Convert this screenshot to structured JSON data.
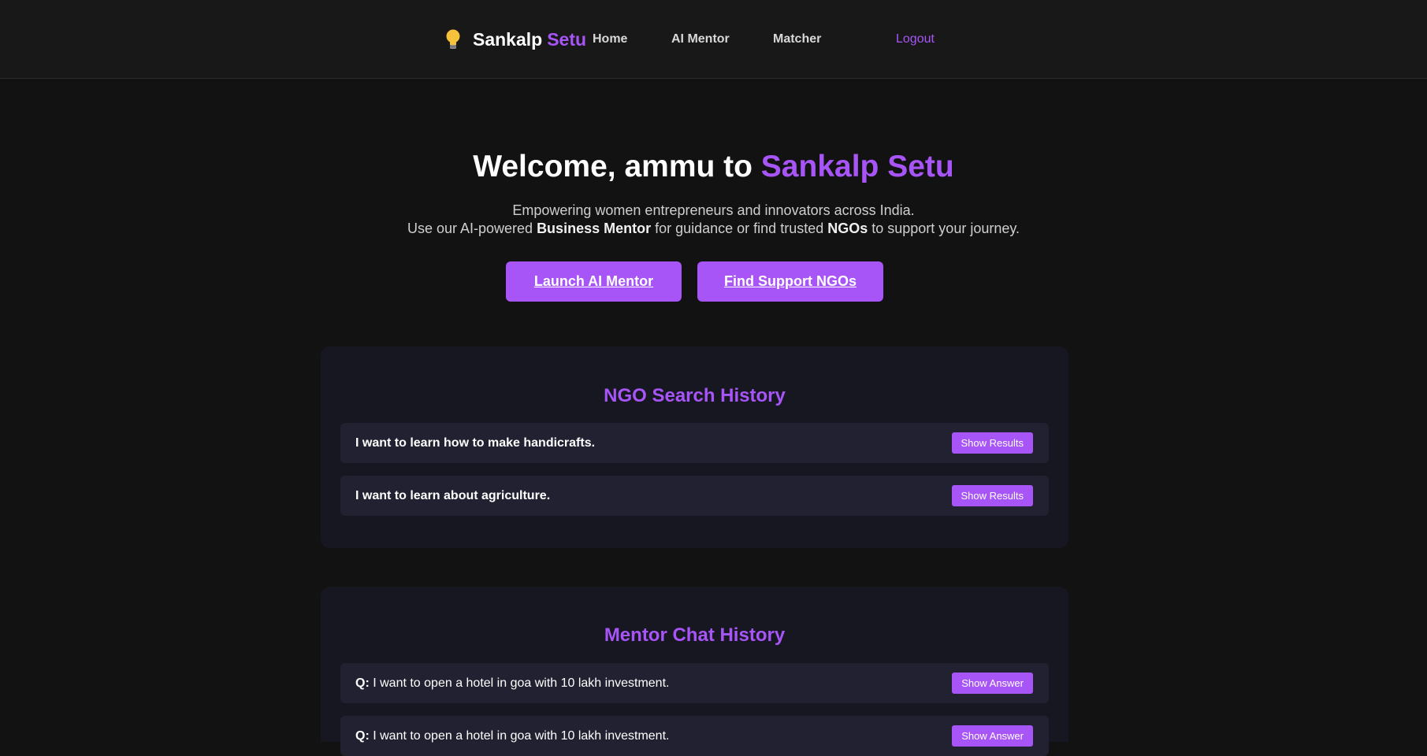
{
  "brand": {
    "name_a": "Sankalp",
    "name_b": "Setu",
    "icon": "lightbulb-icon"
  },
  "nav": {
    "home": "Home",
    "ai_mentor": "AI Mentor",
    "matcher": "Matcher",
    "logout": "Logout"
  },
  "hero": {
    "title_prefix": "Welcome, ammu to ",
    "title_accent": "Sankalp Setu",
    "line1": "Empowering women entrepreneurs and innovators across India.",
    "line2_a": "Use our AI-powered ",
    "line2_b": "Business Mentor",
    "line2_c": " for guidance or find trusted ",
    "line2_d": "NGOs",
    "line2_e": " to support your journey.",
    "btn_mentor": "Launch AI Mentor",
    "btn_ngo": "Find Support NGOs"
  },
  "ngo_history": {
    "title": "NGO Search History",
    "items": [
      {
        "text": "I want to learn how to make handicrafts.",
        "button": "Show Results"
      },
      {
        "text": "I want to learn about agriculture.",
        "button": "Show Results"
      }
    ]
  },
  "chat_history": {
    "title": "Mentor Chat History",
    "q_label": "Q:",
    "items": [
      {
        "text": " I want to open a hotel in goa with 10 lakh investment.",
        "button": "Show Answer"
      },
      {
        "text": " I want to open a hotel in goa with 10 lakh investment.",
        "button": "Show Answer"
      }
    ]
  },
  "colors": {
    "accent": "#a855f7",
    "background": "#121212",
    "card": "#171722",
    "row": "#212131"
  }
}
